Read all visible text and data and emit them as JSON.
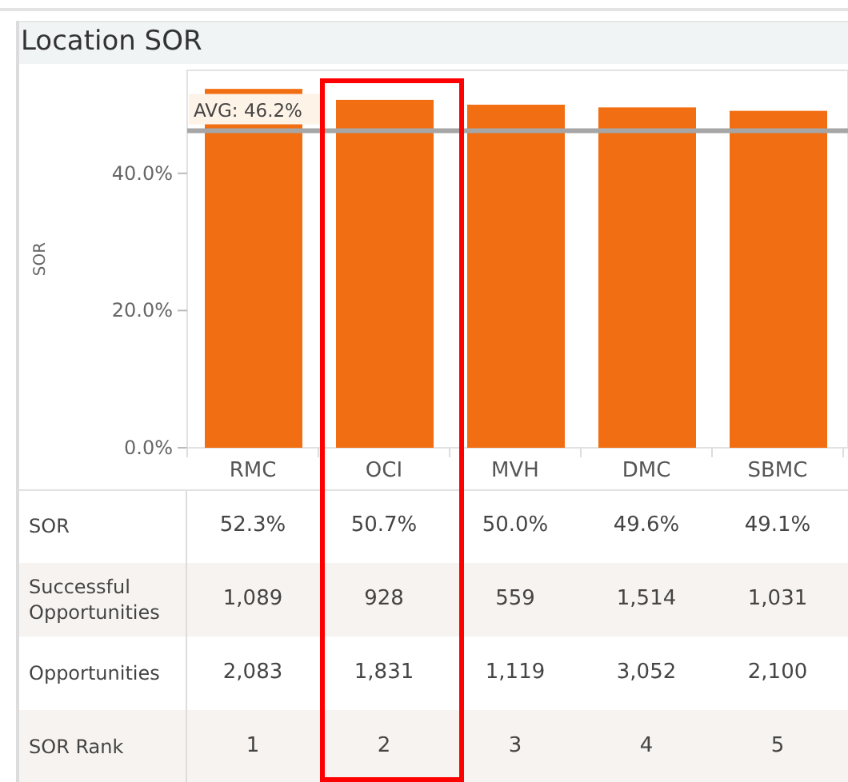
{
  "panel": {
    "title": "Location SOR"
  },
  "chart_data": {
    "type": "bar",
    "ylabel": "SOR",
    "categories": [
      "RMC",
      "OCI",
      "MVH",
      "DMC",
      "SBMC"
    ],
    "values": [
      52.3,
      50.7,
      50.0,
      49.6,
      49.1
    ],
    "ylim": [
      0,
      55
    ],
    "yticks": [
      {
        "value": 0,
        "label": "0.0%"
      },
      {
        "value": 20,
        "label": "20.0%"
      },
      {
        "value": 40,
        "label": "40.0%"
      }
    ],
    "ref_lines": [
      {
        "axis": "y",
        "value": 46.2,
        "label": "AVG: 46.2%",
        "color": "#a6a6a6"
      }
    ]
  },
  "highlighted_columns": [
    false,
    true,
    false,
    false,
    false
  ],
  "table": {
    "rows": [
      {
        "label": "SOR",
        "cells": [
          "52.3%",
          "50.7%",
          "50.0%",
          "49.6%",
          "49.1%"
        ]
      },
      {
        "label": "Successful Opportunities",
        "cells": [
          "1,089",
          "928",
          "559",
          "1,514",
          "1,031"
        ]
      },
      {
        "label": "Opportunities",
        "cells": [
          "2,083",
          "1,831",
          "1,119",
          "3,052",
          "2,100"
        ]
      },
      {
        "label": "SOR Rank",
        "cells": [
          "1",
          "2",
          "3",
          "4",
          "5"
        ]
      }
    ]
  }
}
